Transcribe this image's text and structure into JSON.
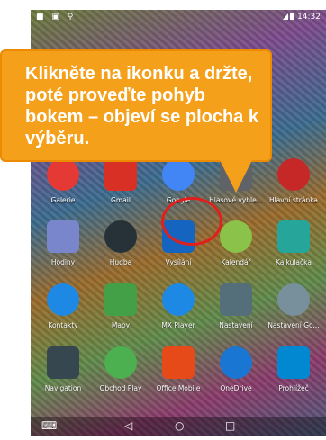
{
  "status_bar": {
    "time": "14:32"
  },
  "callout": {
    "text": "Klikněte na ikonku a držte, poté proveďte pohyb bokem – objeví se plocha k výběru."
  },
  "rows": [
    [
      {
        "label": "Galerie",
        "icon": "gallery-icon",
        "color": "#e53935"
      },
      {
        "label": "Gmail",
        "icon": "gmail-icon",
        "color": "#d93025"
      },
      {
        "label": "Google",
        "icon": "google-icon",
        "color": "#4285f4"
      },
      {
        "label": "Hlasové vyhle...",
        "icon": "voice-search-icon",
        "color": "#5f6368"
      },
      {
        "label": "Hlavní stránka",
        "icon": "homepage-icon",
        "color": "#c62828"
      }
    ],
    [
      {
        "label": "Hodiny",
        "icon": "clock-icon",
        "color": "#7986cb"
      },
      {
        "label": "Hudba",
        "icon": "music-icon",
        "color": "#263238"
      },
      {
        "label": "Vysílání",
        "icon": "broadcast-icon",
        "color": "#1565c0"
      },
      {
        "label": "Kalendář",
        "icon": "calendar-icon",
        "color": "#8bc34a"
      },
      {
        "label": "Kalkulačka",
        "icon": "calculator-icon",
        "color": "#26a69a"
      }
    ],
    [
      {
        "label": "Kontakty",
        "icon": "contacts-icon",
        "color": "#1e88e5"
      },
      {
        "label": "Mapy",
        "icon": "maps-icon",
        "color": "#43a047"
      },
      {
        "label": "MX Player",
        "icon": "mx-player-icon",
        "color": "#1e88e5"
      },
      {
        "label": "Nastavení",
        "icon": "settings-icon",
        "color": "#546e7a"
      },
      {
        "label": "Nastavení Go...",
        "icon": "google-settings-icon",
        "color": "#78909c"
      }
    ],
    [
      {
        "label": "Navigation",
        "icon": "navigation-icon",
        "color": "#37474f"
      },
      {
        "label": "Obchod Play",
        "icon": "play-store-icon",
        "color": "#4caf50"
      },
      {
        "label": "Office Mobile",
        "icon": "office-icon",
        "color": "#e64a19"
      },
      {
        "label": "OneDrive",
        "icon": "onedrive-icon",
        "color": "#1976d2"
      },
      {
        "label": "Prohlížeč",
        "icon": "browser-icon",
        "color": "#0288d1"
      }
    ]
  ],
  "nav": {
    "back_icon": "back-icon",
    "home_icon": "home-icon",
    "recents_icon": "recents-icon"
  }
}
